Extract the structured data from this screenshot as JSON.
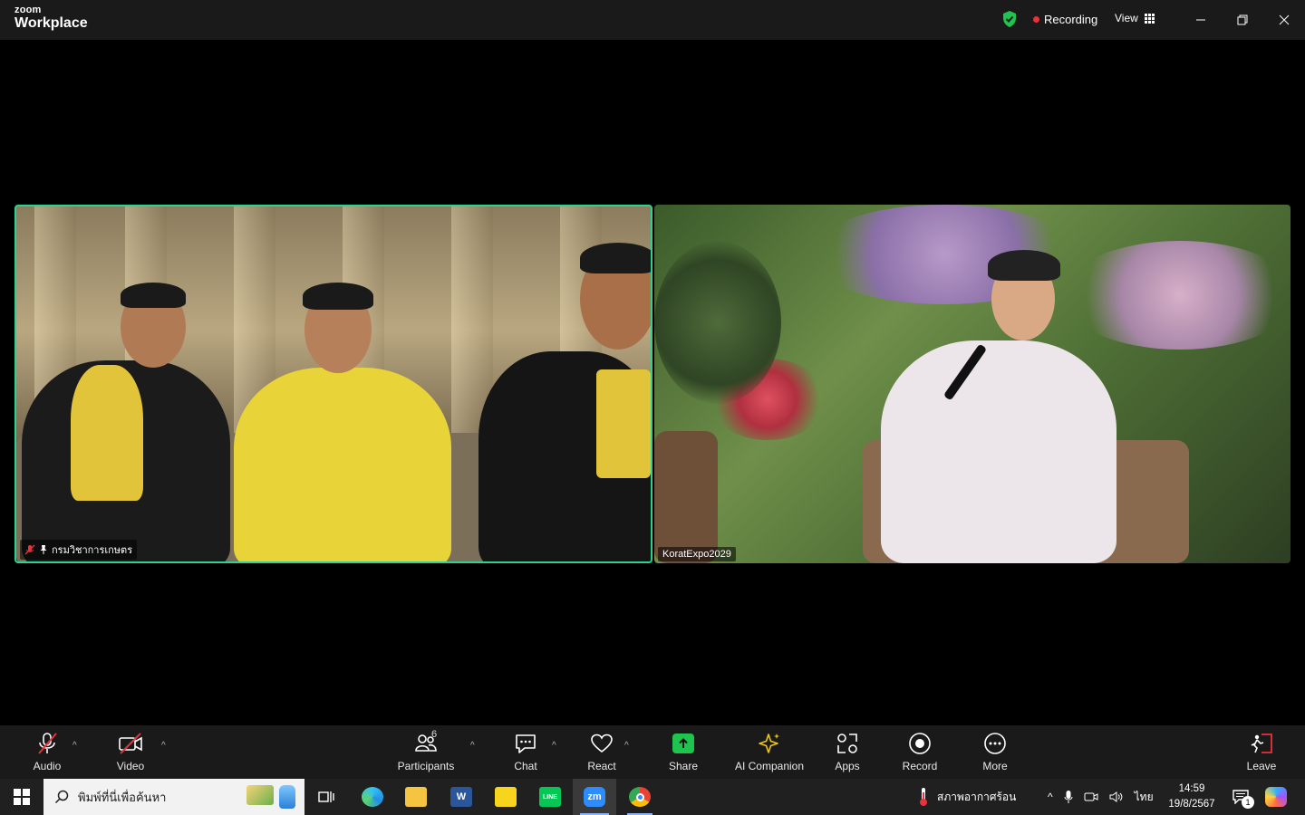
{
  "titlebar": {
    "brand_small": "zoom",
    "brand_large": "Workplace",
    "recording_label": "Recording",
    "view_label": "View",
    "icons": [
      "shield-check-icon",
      "grid-icon",
      "minimize-icon",
      "restore-icon",
      "close-icon"
    ]
  },
  "participants": [
    {
      "name": "กรมวิชาการเกษตร",
      "muted": true,
      "pinned": true,
      "active_speaker": true
    },
    {
      "name": "KoratExpo2029",
      "muted": false,
      "pinned": false,
      "active_speaker": false
    }
  ],
  "toolbar": {
    "audio": "Audio",
    "video": "Video",
    "participants": "Participants",
    "participants_count": "6",
    "chat": "Chat",
    "react": "React",
    "share": "Share",
    "ai_companion": "AI Companion",
    "apps": "Apps",
    "record": "Record",
    "more": "More",
    "leave": "Leave"
  },
  "taskbar": {
    "search_placeholder": "พิมพ์ที่นี่เพื่อค้นหา",
    "apps": [
      "task-view",
      "edge",
      "file-explorer",
      "word",
      "sticky-notes",
      "line",
      "zoom",
      "chrome"
    ],
    "zoom_label": "zm",
    "word_label": "W",
    "line_label": "LINE",
    "weather": "สภาพอากาศร้อน",
    "language": "ไทย",
    "time": "14:59",
    "date": "19/8/2567",
    "notification_count": "1"
  },
  "colors": {
    "active_border": "#29d391",
    "recording_dot": "#e8323c",
    "muted_red": "#e8323c",
    "share_green": "#1ec44d",
    "ai_gold": "#f0c419"
  }
}
